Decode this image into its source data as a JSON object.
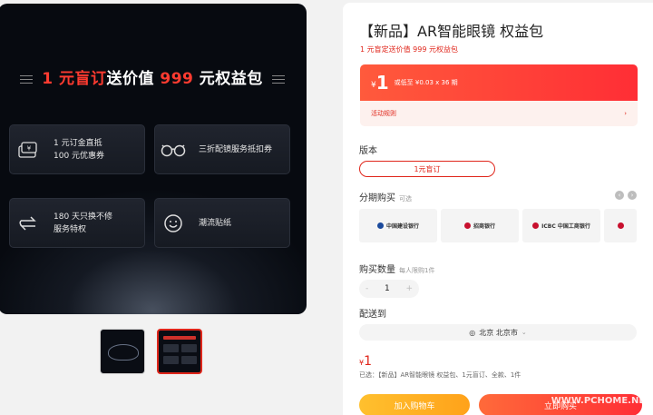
{
  "promo": {
    "headline_red1": "1 元盲订",
    "headline_white1": "送价值 ",
    "headline_red2": "999",
    "headline_white2": " 元权益包",
    "cards": [
      {
        "icon": "coupon-icon",
        "line1": "1 元订金直抵",
        "line2": "100 元优惠券"
      },
      {
        "icon": "glasses-icon",
        "line1": "三折配镜服务抵扣券",
        "line2": ""
      },
      {
        "icon": "exchange-icon",
        "line1": "180 天只换不修",
        "line2": "服务特权"
      },
      {
        "icon": "smiley-icon",
        "line1": "潮流贴纸",
        "line2": ""
      }
    ]
  },
  "product": {
    "title": "【新品】AR智能眼镜 权益包",
    "subtitle": "1 元盲定送价值 999 元权益包",
    "price_yen": "¥",
    "price": "1",
    "installment": "或低至 ¥0.03 x 36 期",
    "rules_label": "活动规则",
    "rules_arrow": "›"
  },
  "version": {
    "label": "版本",
    "option": "1元盲订"
  },
  "installments": {
    "label": "分期购买",
    "hint": "可选",
    "banks": [
      {
        "name": "中国建设银行"
      },
      {
        "name": "招商银行"
      },
      {
        "name": "ICBC 中国工商银行"
      },
      {
        "name": ""
      }
    ]
  },
  "quantity": {
    "label": "购买数量",
    "hint": "每人限购1件",
    "value": "1",
    "minus": "-",
    "plus": "+"
  },
  "delivery": {
    "label": "配送到",
    "location": "北京  北京市",
    "chevron": "⌄"
  },
  "summary": {
    "yen": "¥",
    "price": "1",
    "selected": "已选：【新品】AR智能眼镜 权益包、1元盲订、全款、1件"
  },
  "actions": {
    "cart": "加入购物车",
    "buy": "立即购买"
  },
  "watermark": "WWW.PCHOME.NET"
}
